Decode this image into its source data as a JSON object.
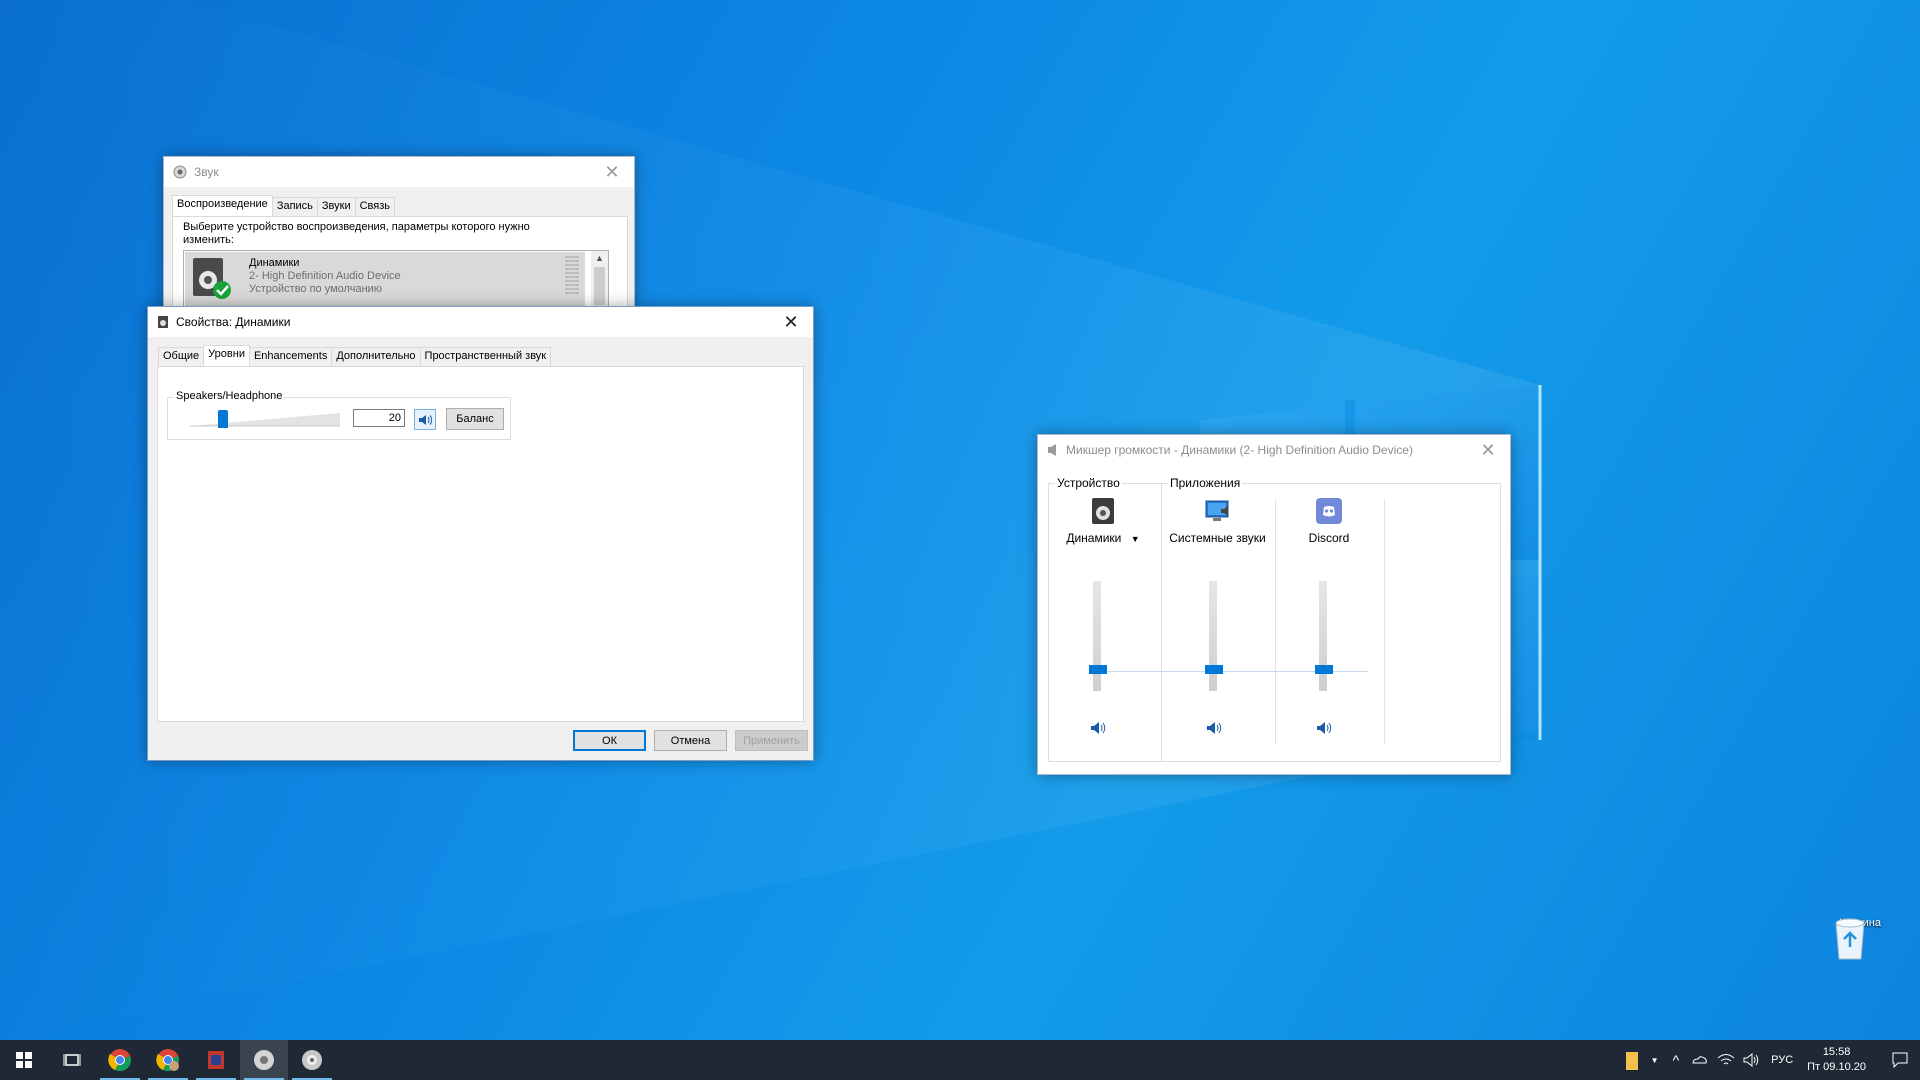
{
  "sound_window": {
    "title": "Звук",
    "tabs": [
      "Воспроизведение",
      "Запись",
      "Звуки",
      "Связь"
    ],
    "active_tab": 0,
    "instruction": "Выберите устройство воспроизведения, параметры которого нужно изменить:",
    "device": {
      "name": "Динамики",
      "desc": "2- High Definition Audio Device",
      "status": "Устройство по умолчанию"
    }
  },
  "properties_window": {
    "title": "Свойства: Динамики",
    "tabs": [
      "Общие",
      "Уровни",
      "Enhancements",
      "Дополнительно",
      "Пространственный звук"
    ],
    "active_tab": 1,
    "level_group_label": "Speakers/Headphone",
    "level_value": "20",
    "level_fraction": 0.2,
    "balance_label": "Баланс",
    "ok_label": "ОК",
    "cancel_label": "Отмена",
    "apply_label": "Применить"
  },
  "mixer_window": {
    "title": "Микшер громкости - Динамики (2- High Definition Audio Device)",
    "device_header": "Устройство",
    "apps_header": "Приложения",
    "columns": [
      {
        "label": "Динамики",
        "icon": "speaker-icon",
        "level": 0.2,
        "has_dropdown": true
      },
      {
        "label": "Системные звуки",
        "icon": "system-sounds-icon",
        "level": 0.2,
        "has_dropdown": false
      },
      {
        "label": "Discord",
        "icon": "discord-icon",
        "level": 0.2,
        "has_dropdown": false
      }
    ]
  },
  "desktop": {
    "recycle_bin_label": "Корзина"
  },
  "taskbar": {
    "apps": [
      "chrome-icon",
      "chrome-profile-icon",
      "app-icon",
      "sound-settings-icon",
      "speaker-app-icon"
    ],
    "language": "РУС",
    "time": "15:58",
    "date": "Пт 09.10.20"
  },
  "colors": {
    "accent": "#0078d7",
    "taskbar": "#1f2935",
    "wallpaper": "#0c8ae6"
  }
}
